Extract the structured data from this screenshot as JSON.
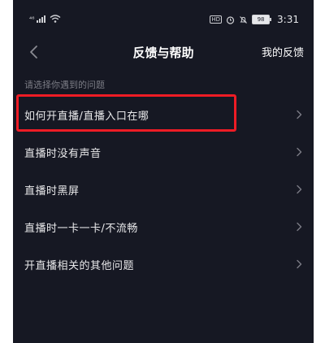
{
  "status_bar": {
    "signal_label": "⁴⁶",
    "hd_label": "HD",
    "battery_level": "98",
    "time": "3:31"
  },
  "nav": {
    "title": "反馈与帮助",
    "right_action": "我的反馈"
  },
  "section_label": "请选择你遇到的问题",
  "problems": [
    {
      "label": "如何开直播/直播入口在哪"
    },
    {
      "label": "直播时没有声音"
    },
    {
      "label": "直播时黑屏"
    },
    {
      "label": "直播时一卡一卡/不流畅"
    },
    {
      "label": "开直播相关的其他问题"
    }
  ],
  "icons": {
    "back": "chevron-left-icon",
    "row_arrow": "chevron-right-icon",
    "wifi": "wifi-icon",
    "alarm": "alarm-icon",
    "mute": "bell-off-icon"
  },
  "colors": {
    "background": "#161823",
    "highlight": "#ee1c25",
    "secondary_text": "#7b7c85"
  }
}
